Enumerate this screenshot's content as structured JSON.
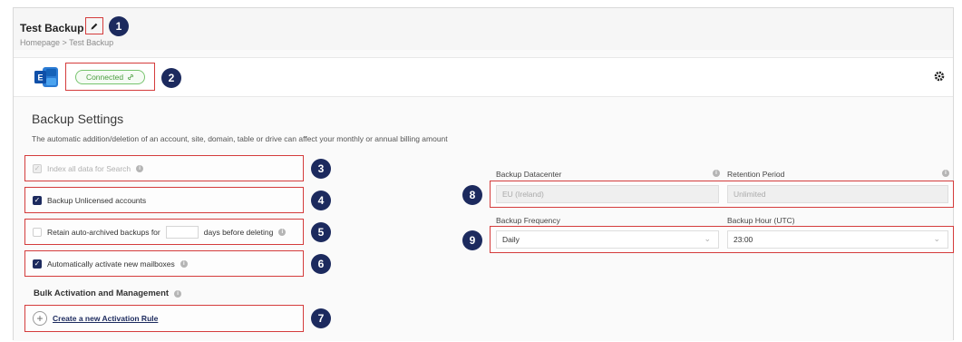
{
  "header": {
    "title": "Test Backup",
    "breadcrumb": "Homepage > Test Backup"
  },
  "connection": {
    "status_label": "Connected"
  },
  "settings": {
    "title": "Backup Settings",
    "subtitle": "The automatic addition/deletion of an account, site, domain, table or drive can affect your monthly or annual billing amount",
    "index_label": "Index all data for Search",
    "unlicensed_label": "Backup Unlicensed accounts",
    "retain_label_before": "Retain auto-archived backups for",
    "retain_label_after": "days before deleting",
    "auto_activate_label": "Automatically activate new mailboxes",
    "bulk_title": "Bulk Activation and Management",
    "create_rule_label": "Create a new Activation Rule"
  },
  "datacenter": {
    "label": "Backup Datacenter",
    "value": "EU (Ireland)"
  },
  "retention": {
    "label": "Retention Period",
    "value": "Unlimited"
  },
  "frequency": {
    "label": "Backup Frequency",
    "value": "Daily"
  },
  "hour": {
    "label": "Backup Hour (UTC)",
    "value": "23:00"
  },
  "badges": [
    "1",
    "2",
    "3",
    "4",
    "5",
    "6",
    "7",
    "8",
    "9"
  ],
  "colors": {
    "highlight": "#d43c3c",
    "badge": "#1c2a5e",
    "connected": "#4a9d3f"
  },
  "icons": [
    "pencil-icon",
    "exchange-icon",
    "link-icon",
    "gear-icon",
    "info-icon",
    "checkbox-icon",
    "plus-icon",
    "chevron-down-icon"
  ]
}
